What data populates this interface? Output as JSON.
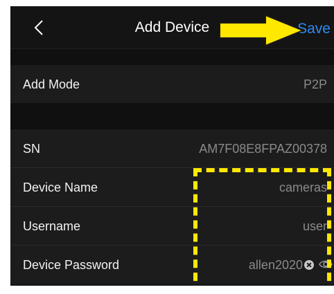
{
  "header": {
    "title": "Add Device",
    "save_label": "Save",
    "back_icon": "chevron-left-icon"
  },
  "rows": {
    "add_mode": {
      "label": "Add Mode",
      "value": "P2P"
    },
    "sn": {
      "label": "SN",
      "value": "AM7F08E8FPAZ00378"
    },
    "device_name": {
      "label": "Device Name",
      "value": "cameras"
    },
    "username": {
      "label": "Username",
      "value": "user"
    },
    "device_password": {
      "label": "Device Password",
      "value": "allen2020"
    }
  },
  "colors": {
    "accent": "#2d8cf0",
    "highlight": "#ffe800",
    "background": "#141414",
    "row": "#1c1c1c"
  },
  "icons": [
    "chevron-left-icon",
    "clear-icon",
    "eye-icon",
    "arrow-annotation-icon"
  ]
}
